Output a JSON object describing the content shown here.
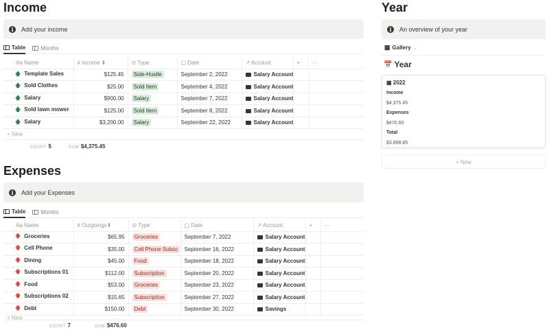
{
  "income": {
    "title": "Income",
    "callout": "Add your income",
    "tabs": [
      "Table",
      "Months"
    ],
    "columns": [
      "Aa Name",
      "# Income ⬇",
      "⊙ Type",
      "▢ Date",
      "↗ Account",
      "+",
      "···"
    ],
    "rows": [
      {
        "name": "Template Sales",
        "amount": "$125.45",
        "type": "Side-Hustle",
        "date": "September 2, 2022",
        "account": "Salary Account"
      },
      {
        "name": "Sold Clothes",
        "amount": "$25.00",
        "type": "Sold Item",
        "date": "September 4, 2022",
        "account": "Salary Account"
      },
      {
        "name": "Salary",
        "amount": "$900.00",
        "type": "Salary",
        "date": "September 7, 2022",
        "account": "Salary Account"
      },
      {
        "name": "Sold lawn mower",
        "amount": "$125.00",
        "type": "Sold Item",
        "date": "September 8, 2022",
        "account": "Salary Account"
      },
      {
        "name": "Salary",
        "amount": "$3,200.00",
        "type": "Salary",
        "date": "September 22, 2022",
        "account": "Salary Account"
      }
    ],
    "new_label": "+ New",
    "count_label": "COUNT",
    "count": "5",
    "sum_label": "SUM",
    "sum": "$4,375.45"
  },
  "expenses": {
    "title": "Expenses",
    "callout": "Add your Expenses",
    "tabs": [
      "Table",
      "Months"
    ],
    "columns": [
      "Aa Name",
      "# Outgoings⬆",
      "⊙ Type",
      "▢ Date",
      "↗ Account",
      "+",
      "···"
    ],
    "rows": [
      {
        "name": "Groceries",
        "amount": "$65.95",
        "type": "Groceries",
        "date": "September 7, 2022",
        "account": "Salary Account"
      },
      {
        "name": "Cell Phone",
        "amount": "$35.00",
        "type": "Cell Phone Subsc",
        "date": "September 16, 2022",
        "account": "Salary Account"
      },
      {
        "name": "Dining",
        "amount": "$45.00",
        "type": "Food",
        "date": "September 18, 2022",
        "account": "Salary Account"
      },
      {
        "name": "Subscriptions 01",
        "amount": "$112.00",
        "type": "Subscription",
        "date": "September 20, 2022",
        "account": "Salary Account"
      },
      {
        "name": "Food",
        "amount": "$53.00",
        "type": "Groceries",
        "date": "September 23, 2022",
        "account": "Salary Account"
      },
      {
        "name": "Subscriptions 02",
        "amount": "$15.65",
        "type": "Subscription",
        "date": "September 27, 2022",
        "account": "Salary Account"
      },
      {
        "name": "Debt",
        "amount": "$150.00",
        "type": "Debt",
        "date": "September 30, 2022",
        "account": "Savings"
      }
    ],
    "new_label": "+ New",
    "count_label": "COUNT",
    "count": "7",
    "sum_label": "SUM",
    "sum": "$476.60"
  },
  "year": {
    "title": "Year",
    "callout": "An overview of your year",
    "view_label": "Gallery",
    "gallery_title": "Year",
    "card": {
      "title": "2022",
      "income_label": "Income",
      "income": "$4,375.45",
      "expenses_label": "Expenses",
      "expenses": "$476.60",
      "total_label": "Total",
      "total": "$3,898.85"
    },
    "new_label": "+ New"
  }
}
